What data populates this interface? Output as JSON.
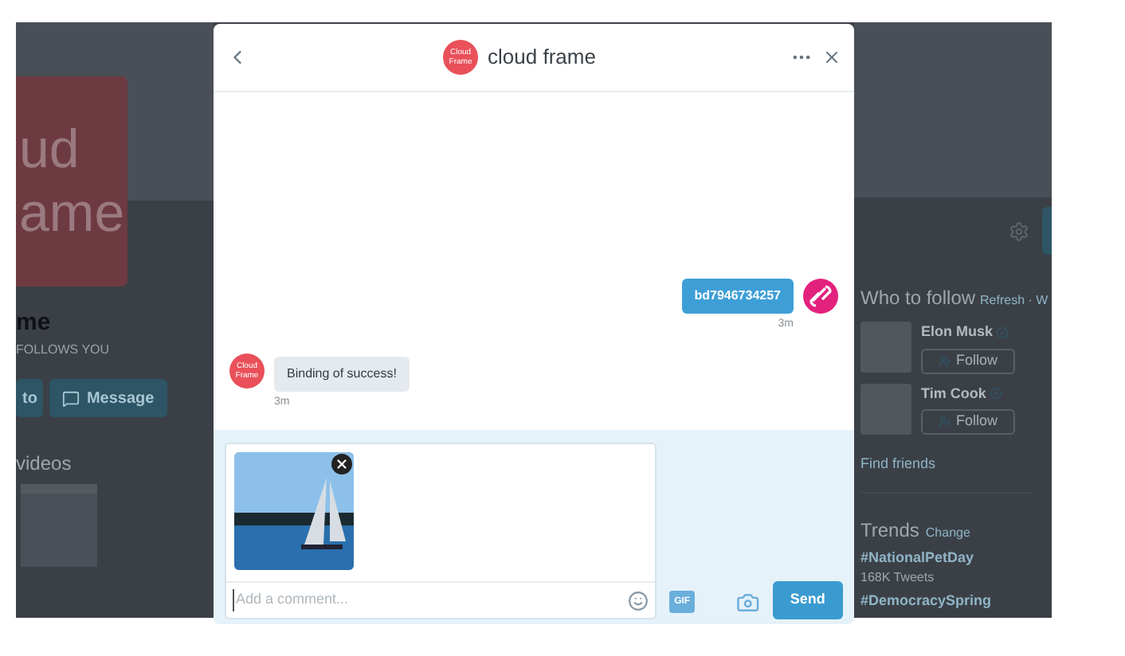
{
  "background_left": {
    "logo_lines": [
      "ud",
      "ame"
    ],
    "name": "me",
    "follows_badge": "FOLLOWS YOU",
    "buttons": [
      "to",
      "Message"
    ],
    "section_title": "videos"
  },
  "background_right": {
    "who_to_follow": {
      "title": "Who to follow",
      "links": "Refresh · W"
    },
    "suggestions": [
      {
        "name": "Elon Musk",
        "button": "Follow"
      },
      {
        "name": "Tim Cook",
        "button": "Follow"
      }
    ],
    "find_friends": "Find friends",
    "trends": {
      "title": "Trends",
      "change": "Change",
      "items": [
        {
          "tag": "#NationalPetDay",
          "count": "168K Tweets"
        },
        {
          "tag": "#DemocracySpring"
        }
      ]
    }
  },
  "dialog": {
    "title": "cloud frame",
    "avatar_text": "Cloud Frame",
    "messages": [
      {
        "kind": "sent",
        "text": "bd7946734257",
        "time": "3m"
      },
      {
        "kind": "received",
        "avatar_text": "Cloud Frame",
        "text": "Binding of success!",
        "time": "3m"
      }
    ],
    "compose": {
      "placeholder": "Add a comment...",
      "gif": "GIF",
      "send": "Send"
    }
  }
}
